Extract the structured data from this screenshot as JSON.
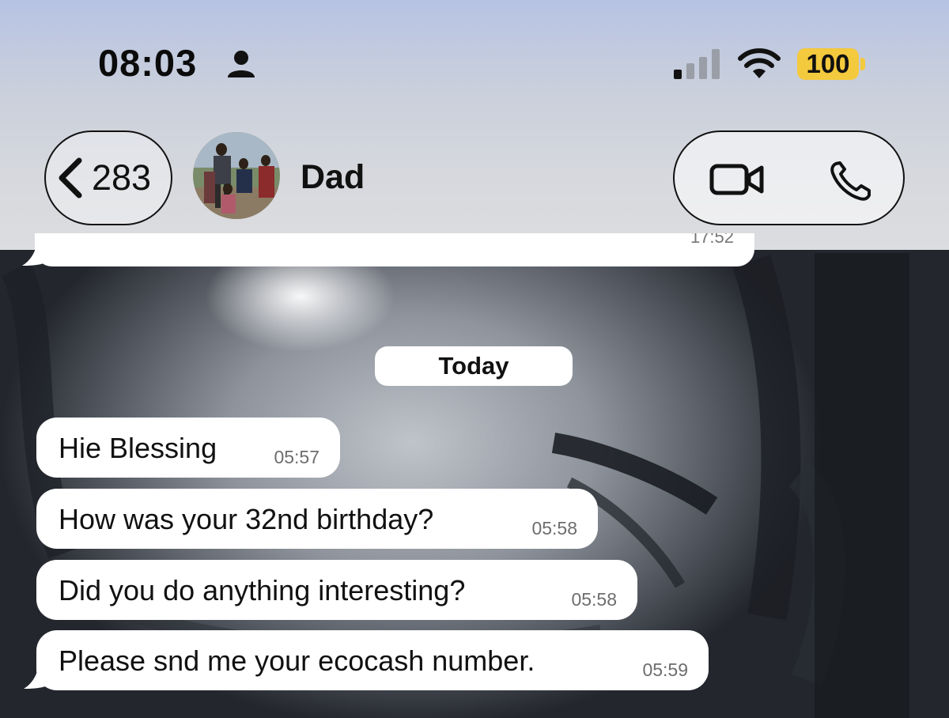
{
  "status_bar": {
    "time": "08:03",
    "battery": "100",
    "icons": [
      "person-icon",
      "cellular-signal-icon",
      "wifi-icon",
      "battery-icon"
    ]
  },
  "header": {
    "back_count": "283",
    "contact_name": "Dad",
    "icons": [
      "chevron-left-icon",
      "video-camera-icon",
      "phone-icon"
    ]
  },
  "chat": {
    "date_separator": "Today",
    "previous_message_time": "17:52",
    "messages": [
      {
        "text": "Hie Blessing",
        "time": "05:57"
      },
      {
        "text": "How was your 32nd birthday?",
        "time": "05:58"
      },
      {
        "text": "Did you do anything interesting?",
        "time": "05:58"
      },
      {
        "text": "Please snd me your ecocash number.",
        "time": "05:59"
      }
    ]
  },
  "colors": {
    "bubble": "#ffffff",
    "battery": "#f3c93d",
    "text": "#111111",
    "timestamp": "#6d6d6d"
  }
}
